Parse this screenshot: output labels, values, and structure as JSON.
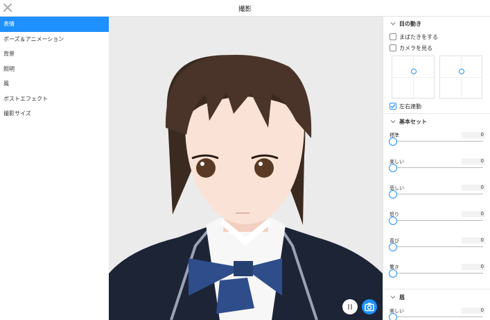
{
  "header": {
    "title": "撮影",
    "close_icon": "close-icon"
  },
  "sidebar": {
    "items": [
      {
        "label": "表情",
        "active": true
      },
      {
        "label": "ポーズ＆アニメーション",
        "active": false
      },
      {
        "label": "背景",
        "active": false
      },
      {
        "label": "照明",
        "active": false
      },
      {
        "label": "風",
        "active": false
      },
      {
        "label": "ポストエフェクト",
        "active": false
      },
      {
        "label": "撮影サイズ",
        "active": false
      }
    ]
  },
  "viewport": {
    "pause_icon": "pause-icon",
    "camera_icon": "camera-icon"
  },
  "panel": {
    "eye": {
      "title": "目の動き",
      "blink_label": "まばたきをする",
      "blink_checked": false,
      "look_camera_label": "カメラを見る",
      "look_camera_checked": false,
      "sync_label": "左右連動",
      "sync_checked": true
    },
    "basic": {
      "title": "基本セット",
      "sliders": [
        {
          "label": "標準",
          "value": "0"
        },
        {
          "label": "楽しい",
          "value": "0"
        },
        {
          "label": "悲しい",
          "value": "0"
        },
        {
          "label": "怒り",
          "value": "0"
        },
        {
          "label": "喜び",
          "value": "0"
        },
        {
          "label": "驚き",
          "value": "0"
        }
      ]
    },
    "brow": {
      "title": "眉",
      "sliders": [
        {
          "label": "楽しい",
          "value": "0"
        }
      ]
    }
  },
  "colors": {
    "accent": "#1e90ff",
    "viewport_bg": "#ebebeb"
  }
}
